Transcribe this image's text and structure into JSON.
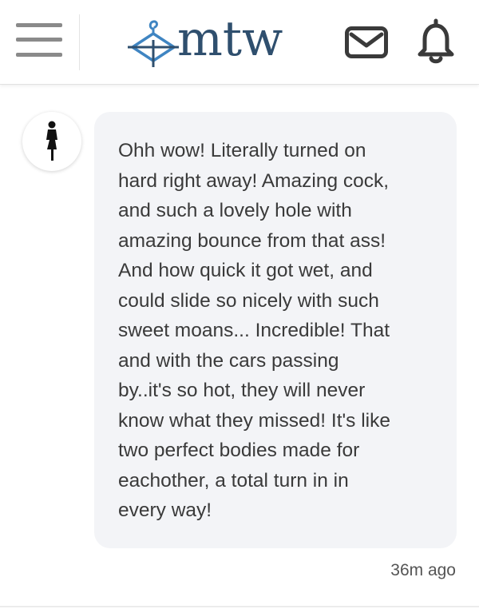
{
  "header": {
    "logo_text": "mtw",
    "menu_icon": "hamburger-menu-icon",
    "mail_icon": "envelope-icon",
    "bell_icon": "bell-icon",
    "brand_color": "#2f4f6e",
    "accent_color": "#3f85c2"
  },
  "comment": {
    "avatar_icon": "female-silhouette-icon",
    "text": "Ohh wow! Literally turned on\nhard right away! Amazing cock,\nand such a lovely hole with\namazing bounce from that ass!\nAnd how quick it got wet, and\ncould slide so nicely with such\nsweet moans... Incredible! That\nand with the cars passing\nby..it's so hot, they will never\nknow what they missed! It's like\ntwo perfect bodies made for\neachother, a total turn in in\nevery way!",
    "timestamp": "36m ago"
  }
}
